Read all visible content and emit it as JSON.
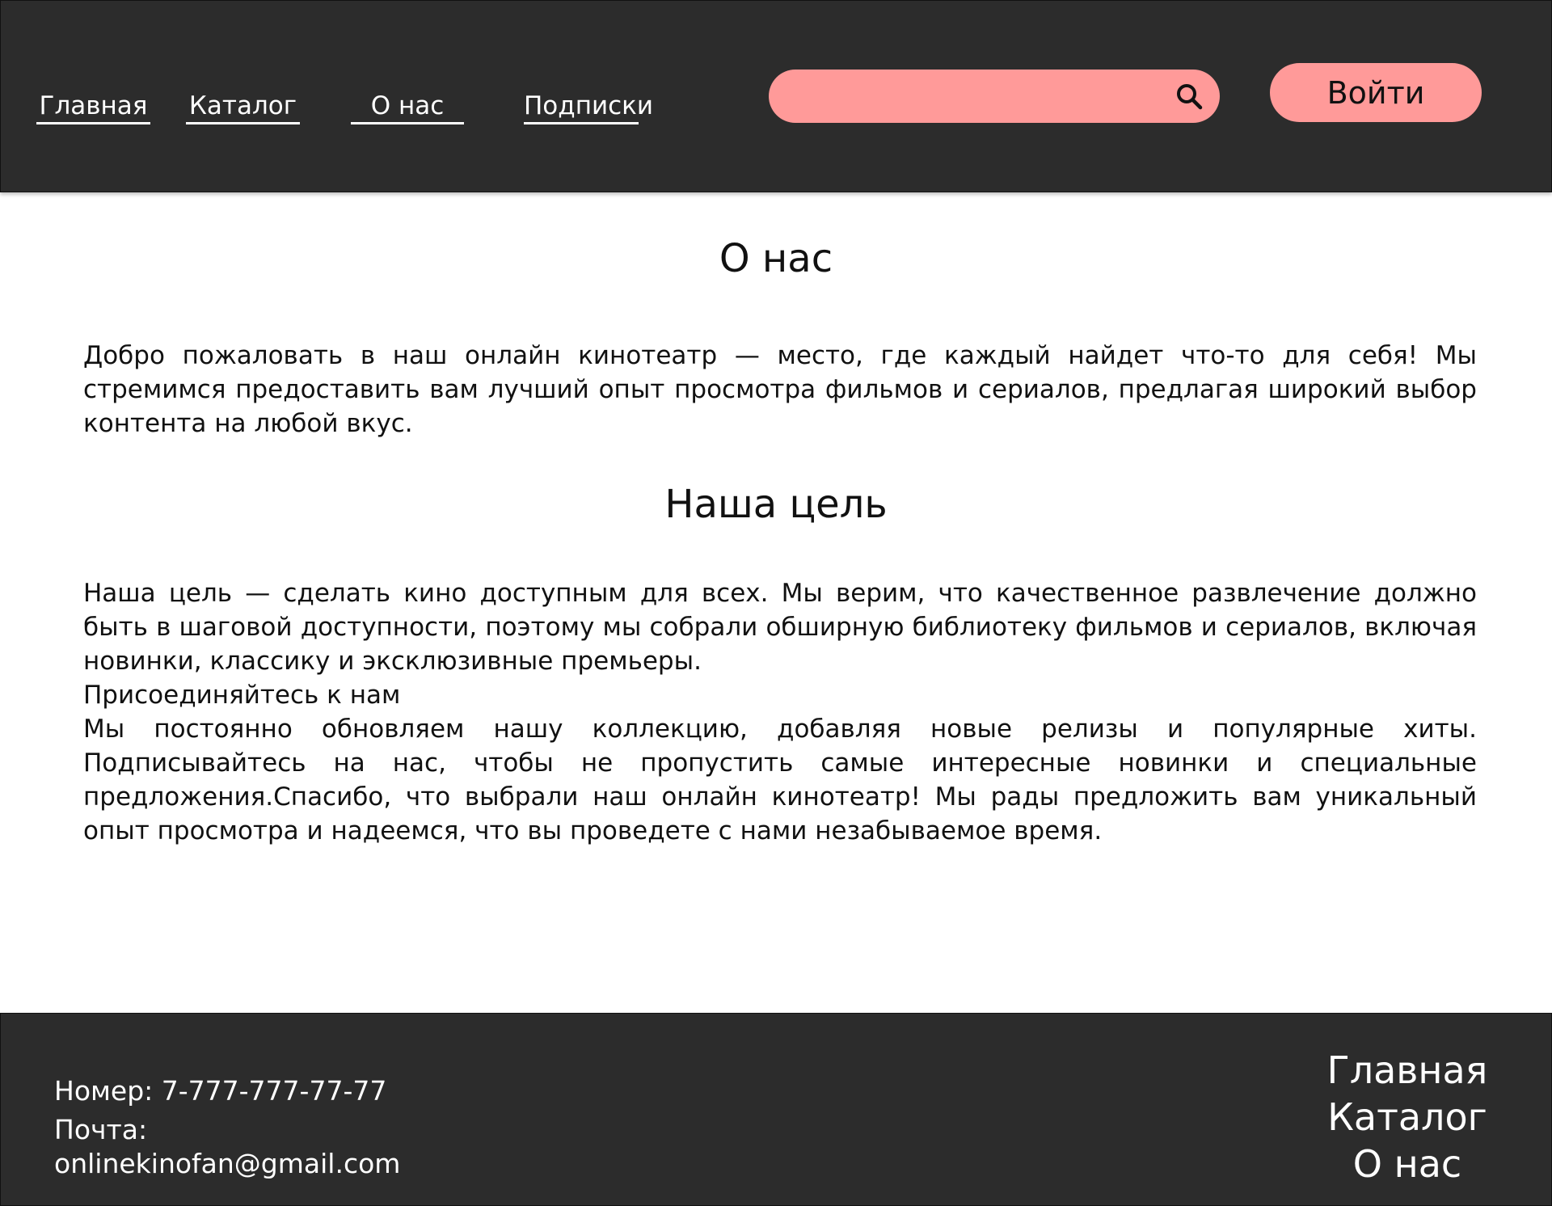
{
  "colors": {
    "header_background": "#2c2c2c",
    "accent": "#ff9a99",
    "page_background": "#ffffff",
    "text_dark": "#111111",
    "text_light": "#ffffff"
  },
  "header": {
    "nav": [
      {
        "label": "Главная",
        "icon": ""
      },
      {
        "label": "Каталог",
        "icon": ""
      },
      {
        "label": "О нас",
        "icon": ""
      },
      {
        "label": "Подписки",
        "icon": ""
      }
    ],
    "search": {
      "value": "",
      "placeholder": "",
      "icon": "search-icon"
    },
    "login_label": "Войти"
  },
  "main": {
    "title": "О нас",
    "intro": "Добро пожаловать в наш онлайн кинотеатр — место, где каждый найдет что-то для себя! Мы стремимся предоставить вам лучший опыт просмотра  фильмов и сериалов, предлагая широкий выбор контента на любой вкус.",
    "goal_title": "Наша цель",
    "goal_text": "Наша цель — сделать кино доступным для всех. Мы верим, что  качественное развлечение должно быть в шаговой доступности, поэтому мы  собрали обширную библиотеку фильмов и сериалов, включая новинки,  классику и эксклюзивные премьеры.",
    "join_title": "Присоединяйтесь к нам",
    "join_text": "Мы постоянно обновляем нашу коллекцию, добавляя новые релизы и  популярные хиты. Подписывайтесь на нас, чтобы не пропустить самые  интересные новинки и специальные предложения.Спасибо, что выбрали наш онлайн кинотеатр! Мы рады предложить вам  уникальный опыт просмотра и надеемся, что вы проведете с нами  незабываемое время."
  },
  "footer": {
    "phone": "Номер: 7-777-777-77-77",
    "mail_label": "Почта:",
    "mail_value": "onlinekinofan@gmail.com",
    "nav": [
      {
        "label": "Главная"
      },
      {
        "label": "Каталог"
      },
      {
        "label": "О нас"
      }
    ]
  }
}
